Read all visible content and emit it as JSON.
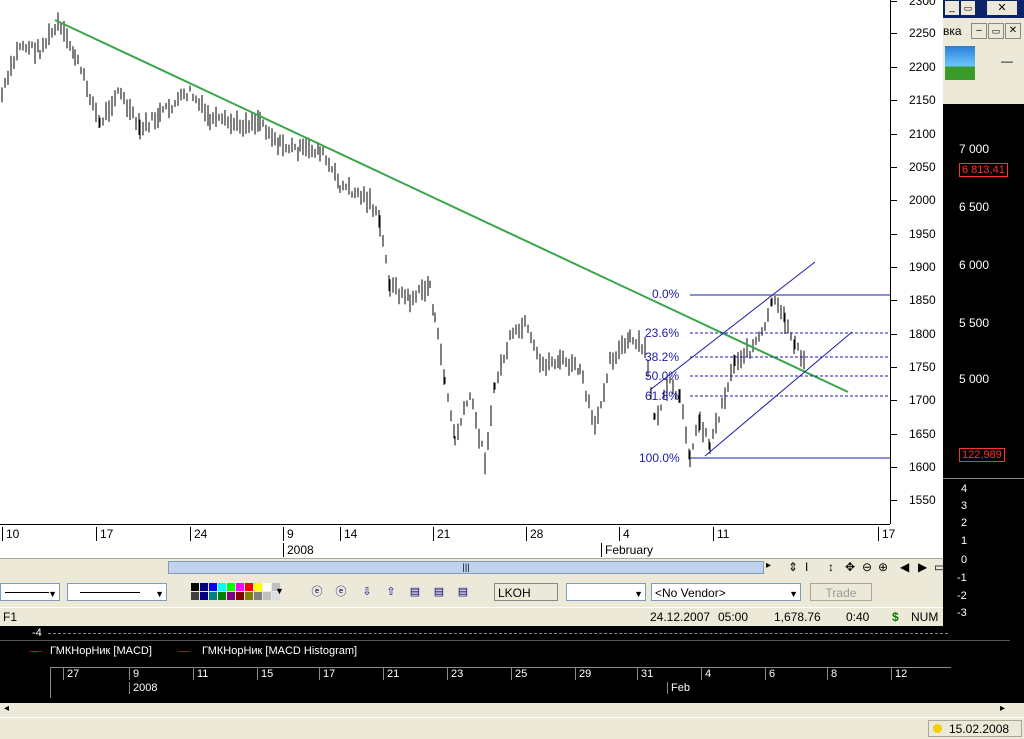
{
  "price_axis": {
    "ticks": [
      "2300",
      "2250",
      "2200",
      "2150",
      "2100",
      "2050",
      "2000",
      "1950",
      "1900",
      "1850",
      "1800",
      "1750",
      "1700",
      "1650",
      "1600",
      "1550"
    ]
  },
  "date_axis": {
    "days": [
      "10",
      "17",
      "24",
      "9",
      "14",
      "21",
      "28",
      "4",
      "11",
      "17"
    ],
    "months": [
      "2008",
      "February"
    ]
  },
  "fibonacci": {
    "levels": [
      "0.0%",
      "23.6%",
      "38.2%",
      "50.0%",
      "61.8%",
      "100.0%"
    ]
  },
  "right_panel": {
    "title": "вка",
    "ticks": [
      "7 000",
      "6 500",
      "6 000",
      "5 500",
      "5 000"
    ],
    "last_price": "6 813,41",
    "indicator_value": "122,989",
    "macd_ticks": [
      "4",
      "3",
      "2",
      "1",
      "0",
      "-1",
      "-2",
      "-3",
      "-4"
    ]
  },
  "toolbar": {
    "symbol": "LKOH",
    "vendor": "<No Vendor>",
    "trade_label": "Trade"
  },
  "status": {
    "f1": "F1",
    "date": "24.12.2007",
    "time": "05:00",
    "value": "1,678.76",
    "duration": "0:40",
    "currency": "$",
    "num": "NUM"
  },
  "lower_panel": {
    "axis_left": "-4",
    "legend_macd": "ГМКНорНик [MACD]",
    "legend_hist": "ГМКНорНик [MACD Histogram]",
    "days": [
      "27",
      "9",
      "11",
      "15",
      "17",
      "21",
      "23",
      "25",
      "29",
      "31",
      "4",
      "6",
      "8",
      "12"
    ],
    "months": [
      "2008",
      "Feb"
    ]
  },
  "taskbar": {
    "date": "15.02.2008"
  },
  "colors": {
    "trendline": "#3aa64a",
    "fib": "#1c1ca6",
    "price_bg": "#ffffff",
    "dark_bg": "#000000",
    "red_value": "#ff3030"
  }
}
